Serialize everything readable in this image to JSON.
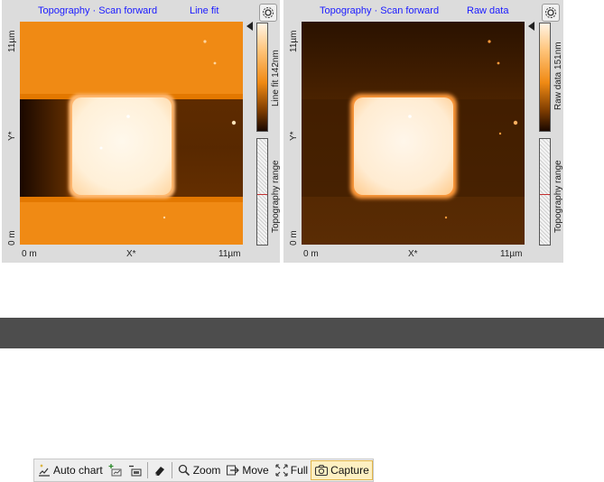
{
  "left_panel": {
    "title": "Topography · Scan forward",
    "mode": "Line fit",
    "y_axis": {
      "top": "11µm",
      "mid": "Y*",
      "bottom": "0 m"
    },
    "x_axis": {
      "left": "0 m",
      "mid": "X*",
      "right": "11µm"
    },
    "colorbar_label": "Line fit 142nm",
    "range_label": "Topography range",
    "image_style": "line-fit"
  },
  "right_panel": {
    "title": "Topography · Scan forward",
    "mode": "Raw data",
    "y_axis": {
      "top": "11µm",
      "mid": "Y*",
      "bottom": "0 m"
    },
    "x_axis": {
      "left": "0 m",
      "mid": "X*",
      "right": "11µm"
    },
    "colorbar_label": "Raw data 151nm",
    "range_label": "Topography range",
    "image_style": "raw-data"
  },
  "toolbar": {
    "auto_chart": "Auto chart",
    "zoom": "Zoom",
    "move": "Move",
    "full": "Full",
    "capture": "Capture"
  },
  "colors": {
    "title_blue": "#1a1aff",
    "divider": "#4d4d4d",
    "capture_highlight": "#fdf0c2"
  }
}
